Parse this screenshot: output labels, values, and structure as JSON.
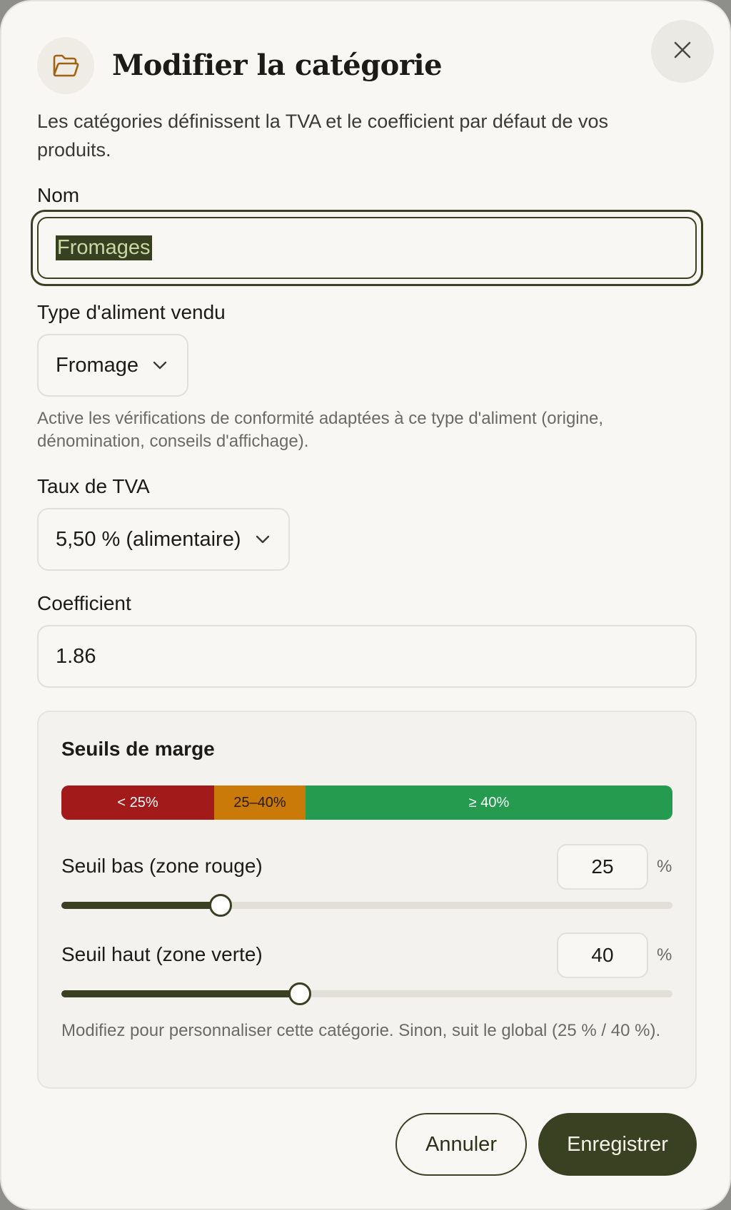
{
  "dialog": {
    "title": "Modifier la catégorie",
    "description": "Les catégories définissent la TVA et le coefficient par défaut de vos produits.",
    "icons": {
      "header": "folder-open-icon",
      "close": "close-icon"
    }
  },
  "fields": {
    "name": {
      "label": "Nom",
      "value": "Fromages"
    },
    "food_type": {
      "label": "Type d'aliment vendu",
      "value": "Fromage",
      "hint": "Active les vérifications de conformité adaptées à ce type d'aliment (origine, dénomination, conseils d'affichage)."
    },
    "vat": {
      "label": "Taux de TVA",
      "value": "5,50 % (alimentaire)"
    },
    "coefficient": {
      "label": "Coefficient",
      "value": "1.86"
    }
  },
  "margins": {
    "title": "Seuils de marge",
    "segments": {
      "low": {
        "label": "< 25%",
        "color": "#a31a1a"
      },
      "mid": {
        "label": "25–40%",
        "color": "#c97a08"
      },
      "high": {
        "label": "≥ 40%",
        "color": "#249b4f"
      }
    },
    "low_threshold": {
      "label": "Seuil bas (zone rouge)",
      "value": "25",
      "unit": "%",
      "slider_fraction": 0.26
    },
    "high_threshold": {
      "label": "Seuil haut (zone verte)",
      "value": "40",
      "unit": "%",
      "slider_fraction": 0.39
    },
    "hint": "Modifiez pour personnaliser cette catégorie. Sinon, suit le global (25 % / 40 %)."
  },
  "actions": {
    "cancel": "Annuler",
    "save": "Enregistrer"
  },
  "colors": {
    "primary": "#3a4122",
    "background": "#f8f7f3"
  }
}
